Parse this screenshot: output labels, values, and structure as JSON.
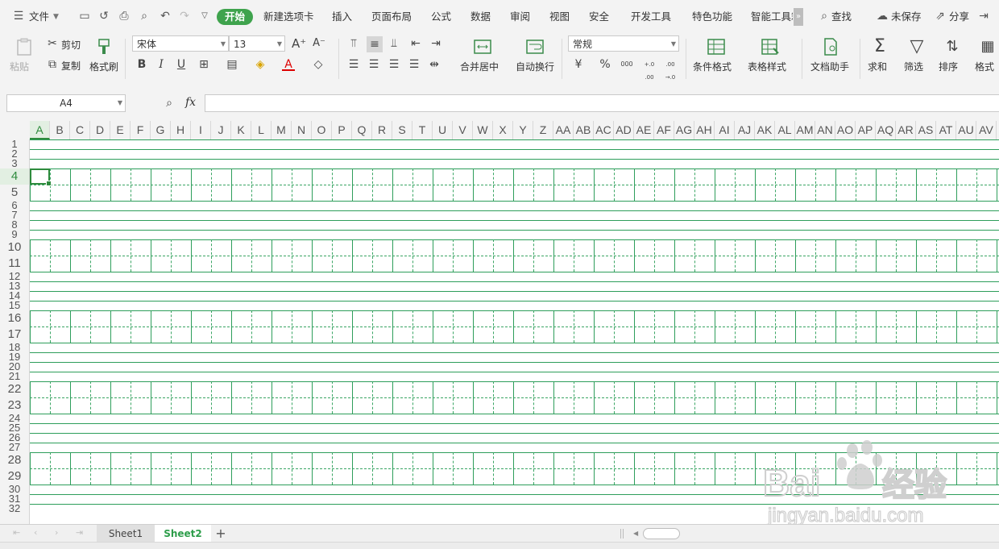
{
  "menubar": {
    "file": "文件",
    "tabs": [
      "开始",
      "新建选项卡",
      "插入",
      "页面布局",
      "公式",
      "数据",
      "审阅",
      "视图",
      "安全",
      "开发工具",
      "特色功能",
      "智能工具箱"
    ],
    "search": "查找",
    "unsaved": "未保存",
    "share": "分享",
    "more_chevron": "»"
  },
  "ribbon": {
    "paste": "粘贴",
    "cut": "剪切",
    "copy": "复制",
    "format_painter": "格式刷",
    "font_name": "宋体",
    "font_size": "13",
    "bold": "B",
    "italic": "I",
    "underline": "U",
    "merge_center": "合并居中",
    "wrap_text": "自动换行",
    "number_format": "常规",
    "currency": "¥",
    "percent": "%",
    "thousands": "000",
    "dec_inc": "+.0 .00",
    "dec_dec": ".00 →.0",
    "conditional_format": "条件格式",
    "table_style": "表格样式",
    "doc_assistant": "文档助手",
    "sum": "求和",
    "filter": "筛选",
    "sort": "排序",
    "format": "格式"
  },
  "formula": {
    "name_box": "A4",
    "fx": "fx",
    "value": ""
  },
  "grid": {
    "columns": [
      "A",
      "B",
      "C",
      "D",
      "E",
      "F",
      "G",
      "H",
      "I",
      "J",
      "K",
      "L",
      "M",
      "N",
      "O",
      "P",
      "Q",
      "R",
      "S",
      "T",
      "U",
      "V",
      "W",
      "X",
      "Y",
      "Z",
      "AA",
      "AB",
      "AC",
      "AD",
      "AE",
      "AF",
      "AG",
      "AH",
      "AI",
      "AJ",
      "AK",
      "AL",
      "AM",
      "AN",
      "AO",
      "AP",
      "AQ",
      "AR",
      "AS",
      "AT",
      "AU",
      "AV"
    ],
    "rows": [
      "1",
      "2",
      "3",
      "4",
      "5",
      "6",
      "7",
      "8",
      "9",
      "10",
      "11",
      "12",
      "13",
      "14",
      "15",
      "16",
      "17",
      "18",
      "19",
      "20",
      "21",
      "22",
      "23",
      "24",
      "25",
      "26",
      "27",
      "28",
      "29",
      "30",
      "31",
      "32"
    ],
    "selected_cell": "A4",
    "grid_color": "#2e9e5b"
  },
  "sheets": {
    "tabs": [
      "Sheet1",
      "Sheet2"
    ],
    "active": "Sheet2",
    "add": "+"
  },
  "watermark": {
    "brand": "Bai",
    "brand_cn": "经验",
    "url": "jingyan.baidu.com"
  },
  "colors": {
    "accent": "#3fa34d",
    "grid": "#2e9e5b"
  }
}
